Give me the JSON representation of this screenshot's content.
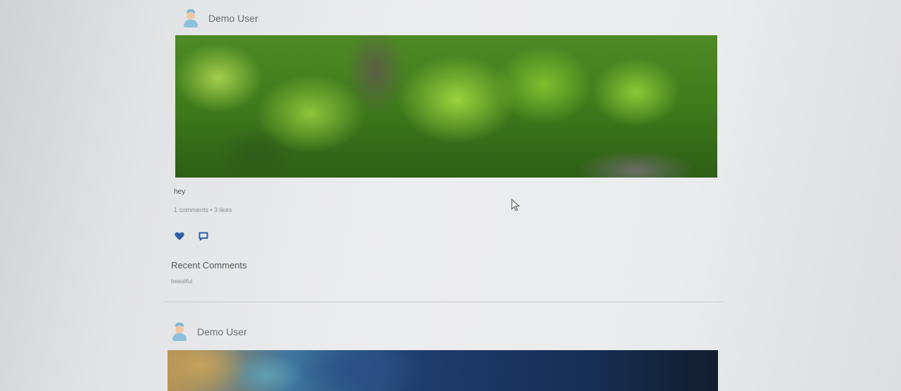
{
  "feed": {
    "posts": [
      {
        "author": "Demo User",
        "avatar_icon": "user-avatar-icon",
        "caption": "hey",
        "meta": "1 comments • 3 likes",
        "actions": {
          "like_icon": "heart-icon",
          "comment_icon": "comment-icon"
        },
        "comments_heading": "Recent Comments",
        "comments": [
          "beautiful"
        ]
      },
      {
        "author": "Demo User",
        "avatar_icon": "user-avatar-icon"
      }
    ]
  },
  "colors": {
    "accent": "#2d5fa8",
    "page_bg": "#e9eaec",
    "text_muted": "#8a8d92"
  }
}
